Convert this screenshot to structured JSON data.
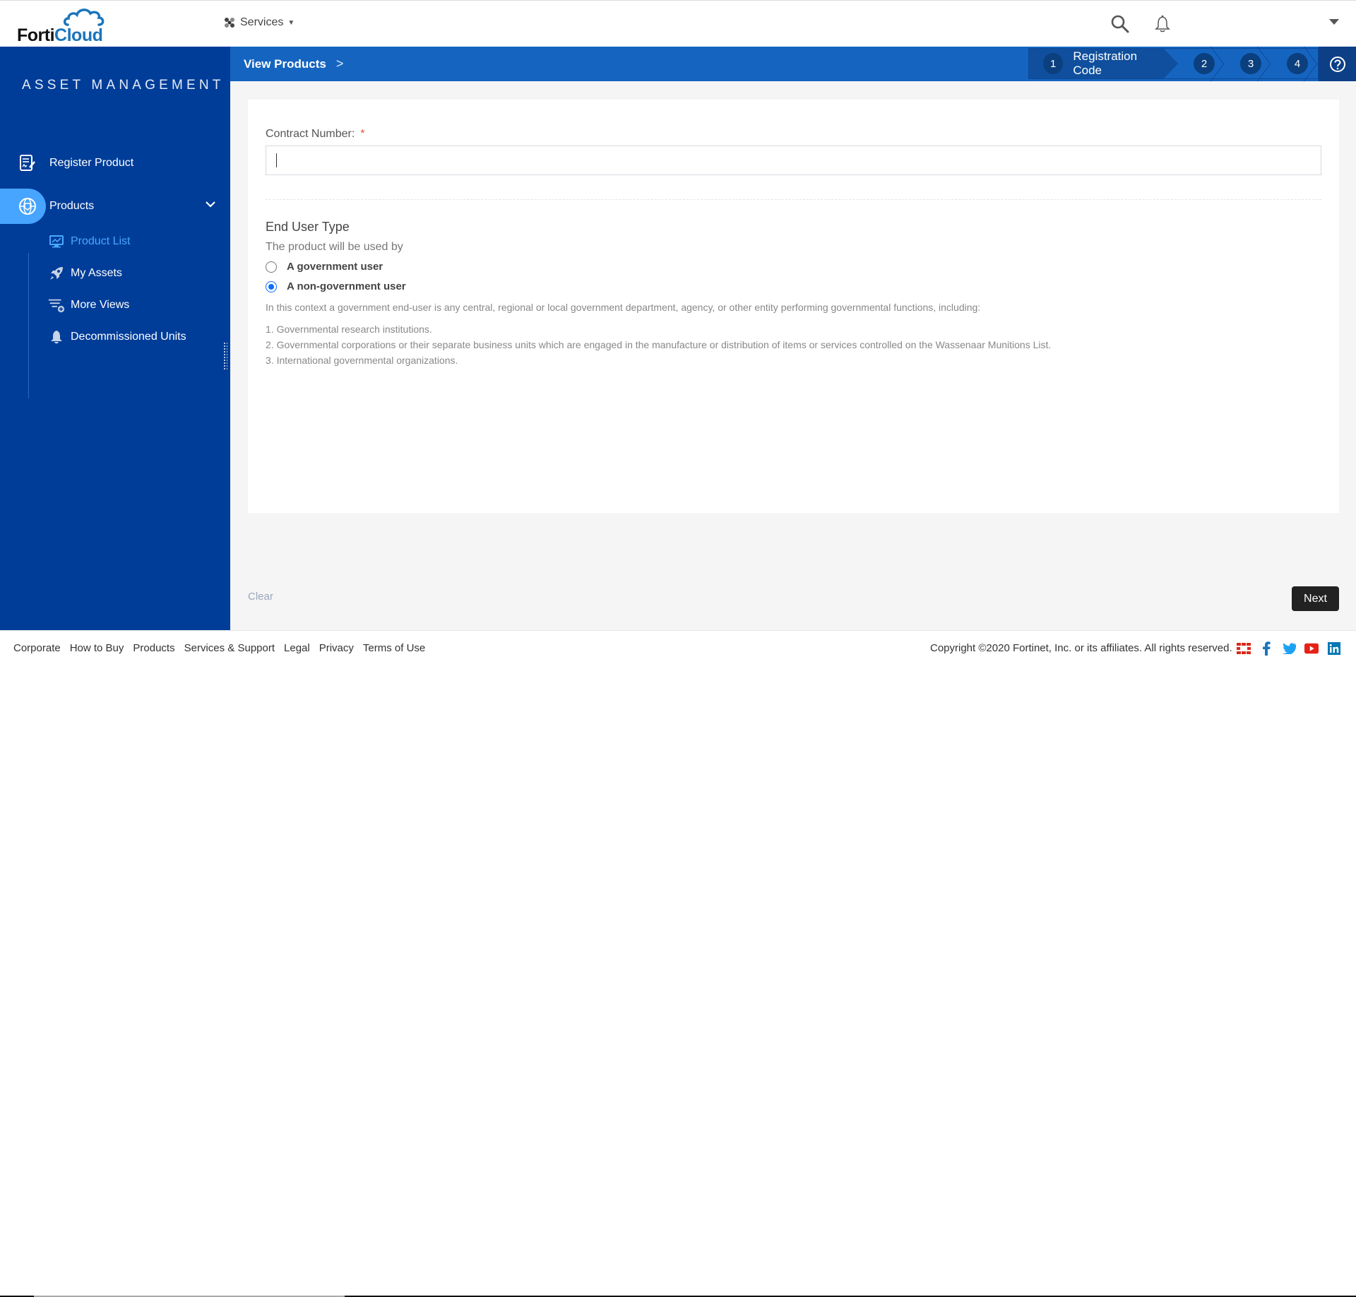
{
  "header": {
    "logo_text_1": "Forti",
    "logo_text_2": "Cloud",
    "services_label": "Services",
    "icons": [
      "search-icon",
      "bell-icon",
      "user-menu-caret"
    ]
  },
  "sidebar": {
    "title": "ASSET MANAGEMENT",
    "items": [
      {
        "label": "Register Product",
        "icon": "register-product-icon"
      },
      {
        "label": "Products",
        "icon": "products-globe-icon",
        "expanded": true
      }
    ],
    "sub_items": [
      {
        "label": "Product List",
        "icon": "monitor-chart-icon",
        "active": true
      },
      {
        "label": "My Assets",
        "icon": "rocket-icon"
      },
      {
        "label": "More Views",
        "icon": "filter-plus-icon"
      },
      {
        "label": "Decommissioned Units",
        "icon": "bell-icon"
      }
    ]
  },
  "breadcrumb": {
    "label": "View Products",
    "separator": ">"
  },
  "wizard": {
    "steps": [
      {
        "number": "1",
        "label": "Registration Code",
        "active": true
      },
      {
        "number": "2"
      },
      {
        "number": "3"
      },
      {
        "number": "4"
      }
    ],
    "help_icon": "question-circle-icon"
  },
  "form": {
    "contract_label": "Contract Number:",
    "required_mark": "*",
    "contract_value": "",
    "section_title": "End User Type",
    "section_subtitle": "The product will be used by",
    "options": [
      {
        "label": "A government user",
        "checked": false
      },
      {
        "label": "A non-government user",
        "checked": true
      }
    ],
    "note": "In this context a government end-user is any central, regional or local government department, agency, or other entity performing governmental functions, including:",
    "list": [
      "1. Governmental research institutions.",
      "2. Governmental corporations or their separate business units which are engaged in the manufacture or distribution of items or services controlled on the Wassenaar Munitions List.",
      "3. International governmental organizations."
    ]
  },
  "actions": {
    "clear_label": "Clear",
    "next_label": "Next"
  },
  "footer": {
    "links": [
      "Corporate",
      "How to Buy",
      "Products",
      "Services & Support",
      "Legal",
      "Privacy",
      "Terms of Use"
    ],
    "copyright": "Copyright ©2020 Fortinet, Inc. or its affiliates. All rights reserved.",
    "social": [
      "fortinet-icon",
      "facebook-icon",
      "twitter-icon",
      "youtube-icon",
      "linkedin-icon"
    ],
    "colors": {
      "fortinet": "#da291c",
      "facebook": "#1b75bb",
      "twitter": "#1da1f2",
      "youtube": "#e62117",
      "linkedin": "#0077b5"
    }
  },
  "colors": {
    "sidebar_bg": "#003d99",
    "crumbbar_bg": "#1565c0",
    "active_pill": "#47a4ff",
    "active_sub": "#4aa8ff",
    "radio_checked": "#0d6efd",
    "next_btn": "#222222"
  }
}
